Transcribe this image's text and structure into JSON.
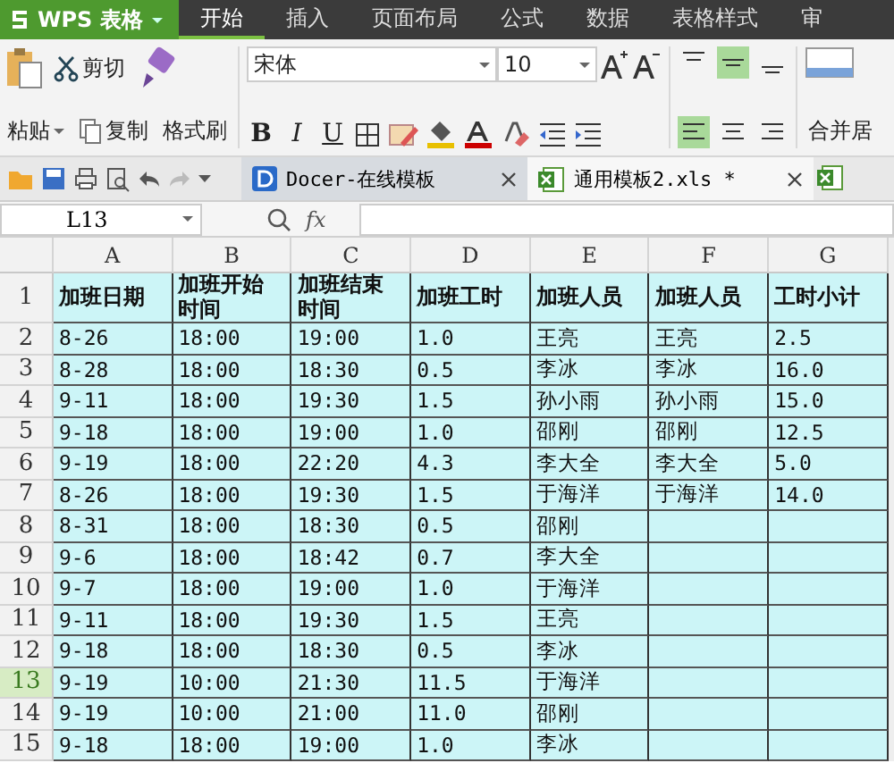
{
  "title_bar": {
    "app_name": "WPS 表格",
    "menu_tabs": [
      {
        "label": "开始",
        "selected": true
      },
      {
        "label": "插入",
        "selected": false
      },
      {
        "label": "页面布局",
        "selected": false
      },
      {
        "label": "公式",
        "selected": false
      },
      {
        "label": "数据",
        "selected": false
      },
      {
        "label": "表格样式",
        "selected": false
      },
      {
        "label": "审",
        "selected": false
      }
    ]
  },
  "ribbon": {
    "paste": "粘贴",
    "cut": "剪切",
    "copy": "复制",
    "format_painter": "格式刷",
    "font_name": "宋体",
    "font_size": "10",
    "bold": "B",
    "italic": "I",
    "underline": "U",
    "merge": "合并居"
  },
  "document_tabs": [
    {
      "label": "Docer-在线模板",
      "kind": "docer",
      "selected": false
    },
    {
      "label": "通用模板2.xls *",
      "kind": "sheet",
      "selected": true
    }
  ],
  "formula_bar": {
    "name_box": "L13",
    "fx": "fx"
  },
  "sheet": {
    "columns": [
      "A",
      "B",
      "C",
      "D",
      "E",
      "F",
      "G"
    ],
    "rows": [
      {
        "number": "1",
        "selected": false,
        "cells": [
          "加班日期",
          "加班开始时间",
          "加班结束时间",
          "加班工时",
          "加班人员",
          "加班人员",
          "工时小计"
        ]
      },
      {
        "number": "2",
        "selected": false,
        "cells": [
          "8-26",
          "18:00",
          "19:00",
          "1.0",
          "王亮",
          "王亮",
          "2.5"
        ]
      },
      {
        "number": "3",
        "selected": false,
        "cells": [
          "8-28",
          "18:00",
          "18:30",
          "0.5",
          "李冰",
          "李冰",
          "16.0"
        ]
      },
      {
        "number": "4",
        "selected": false,
        "cells": [
          "9-11",
          "18:00",
          "19:30",
          "1.5",
          "孙小雨",
          "孙小雨",
          "15.0"
        ]
      },
      {
        "number": "5",
        "selected": false,
        "cells": [
          "9-18",
          "18:00",
          "19:00",
          "1.0",
          "邵刚",
          "邵刚",
          "12.5"
        ]
      },
      {
        "number": "6",
        "selected": false,
        "cells": [
          "9-19",
          "18:00",
          "22:20",
          "4.3",
          "李大全",
          "李大全",
          "5.0"
        ]
      },
      {
        "number": "7",
        "selected": false,
        "cells": [
          "8-26",
          "18:00",
          "19:30",
          "1.5",
          "于海洋",
          "于海洋",
          "14.0"
        ]
      },
      {
        "number": "8",
        "selected": false,
        "cells": [
          "8-31",
          "18:00",
          "18:30",
          "0.5",
          "邵刚",
          "",
          ""
        ]
      },
      {
        "number": "9",
        "selected": false,
        "cells": [
          "9-6",
          "18:00",
          "18:42",
          "0.7",
          "李大全",
          "",
          ""
        ]
      },
      {
        "number": "10",
        "selected": false,
        "cells": [
          "9-7",
          "18:00",
          "19:00",
          "1.0",
          "于海洋",
          "",
          ""
        ]
      },
      {
        "number": "11",
        "selected": false,
        "cells": [
          "9-11",
          "18:00",
          "19:30",
          "1.5",
          "王亮",
          "",
          ""
        ]
      },
      {
        "number": "12",
        "selected": false,
        "cells": [
          "9-18",
          "18:00",
          "18:30",
          "0.5",
          "李冰",
          "",
          ""
        ]
      },
      {
        "number": "13",
        "selected": true,
        "cells": [
          "9-19",
          "10:00",
          "21:30",
          "11.5",
          "于海洋",
          "",
          ""
        ]
      },
      {
        "number": "14",
        "selected": false,
        "cells": [
          "9-19",
          "10:00",
          "21:00",
          "11.0",
          "邵刚",
          "",
          ""
        ]
      },
      {
        "number": "15",
        "selected": false,
        "cells": [
          "9-18",
          "18:00",
          "19:00",
          "1.0",
          "李冰",
          "",
          ""
        ]
      }
    ]
  }
}
